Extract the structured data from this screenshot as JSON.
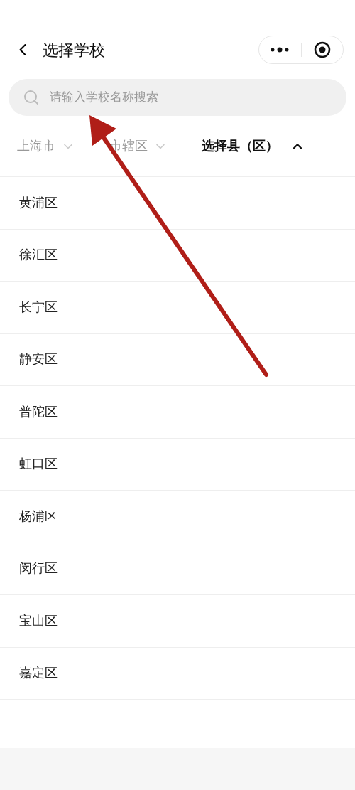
{
  "nav": {
    "title": "选择学校"
  },
  "search": {
    "placeholder": "请输入学校名称搜索"
  },
  "tabs": [
    {
      "label": "上海市",
      "selected": false
    },
    {
      "label": "市辖区",
      "selected": false
    },
    {
      "label": "选择县（区）",
      "selected": true
    }
  ],
  "districts": [
    "黄浦区",
    "徐汇区",
    "长宁区",
    "静安区",
    "普陀区",
    "虹口区",
    "杨浦区",
    "闵行区",
    "宝山区",
    "嘉定区"
  ]
}
